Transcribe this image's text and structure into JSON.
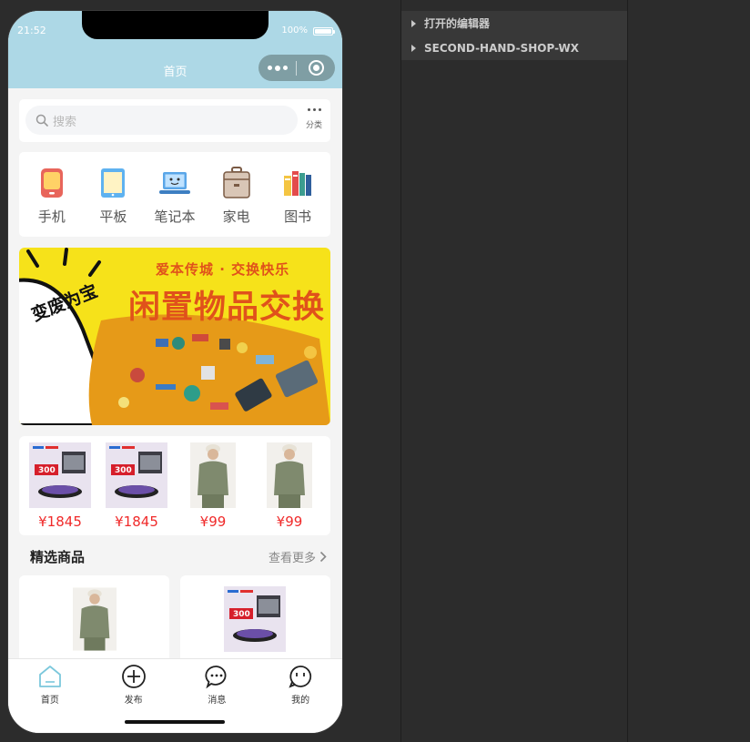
{
  "status_bar": {
    "time": "21:52",
    "battery": "100%"
  },
  "nav": {
    "title": "首页"
  },
  "search": {
    "placeholder": "搜索",
    "category_label": "分类"
  },
  "categories": [
    {
      "label": "手机",
      "icon": "phone-icon"
    },
    {
      "label": "平板",
      "icon": "tablet-icon"
    },
    {
      "label": "笔记本",
      "icon": "laptop-icon"
    },
    {
      "label": "家电",
      "icon": "appliance-icon"
    },
    {
      "label": "图书",
      "icon": "books-icon"
    }
  ],
  "banner": {
    "slogan": "爱本传城 · 交换快乐",
    "title": "闲置物品交换",
    "badge": "变废为宝",
    "colors": {
      "background": "#f6e21a",
      "text": "#e0521b"
    }
  },
  "hot_items": [
    {
      "price": "¥1845",
      "image": "robot-vacuum"
    },
    {
      "price": "¥1845",
      "image": "robot-vacuum"
    },
    {
      "price": "¥99",
      "image": "sweater-model"
    },
    {
      "price": "¥99",
      "image": "sweater-model"
    }
  ],
  "featured": {
    "title": "精选商品",
    "more": "查看更多"
  },
  "tabbar": [
    {
      "label": "首页",
      "icon": "home-icon"
    },
    {
      "label": "发布",
      "icon": "add-circle-icon"
    },
    {
      "label": "消息",
      "icon": "chat-icon"
    },
    {
      "label": "我的",
      "icon": "profile-icon"
    }
  ],
  "explorer": {
    "items": [
      "打开的编辑器",
      "SECOND-HAND-SHOP-WX"
    ]
  },
  "colors": {
    "header": "#add8e6",
    "price": "#f02a2a",
    "ide_background": "#2c2c2c"
  }
}
